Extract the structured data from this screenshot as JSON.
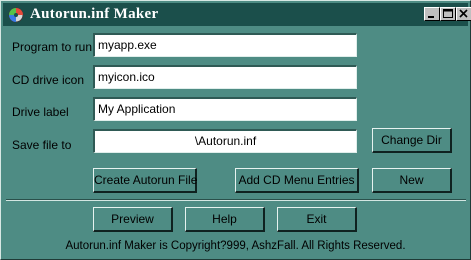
{
  "window": {
    "title": "Autorun.inf Maker",
    "icon": "app-cd-icon",
    "controls": [
      "minimize-icon",
      "maximize-icon",
      "close-icon"
    ]
  },
  "form": {
    "program_label": "Program to run",
    "program_value": "myapp.exe",
    "icon_label": "CD drive icon",
    "icon_value": "myicon.ico",
    "drive_label": "Drive label",
    "drive_value": "My Application",
    "save_label": "Save file to",
    "save_value": "\\Autorun.inf"
  },
  "buttons": {
    "change_dir": "Change Dir",
    "create": "Create Autorun File",
    "add_menu": "Add CD Menu Entries",
    "new": "New",
    "preview": "Preview",
    "help": "Help",
    "exit": "Exit"
  },
  "footer": {
    "copyright": "Autorun.inf Maker is Copyright?999, AshzFall.  All Rights Reserved."
  },
  "colors": {
    "window_bg": "#4e8c84",
    "titlebar": "#1b4f4b",
    "field_bg": "#ffffff"
  }
}
